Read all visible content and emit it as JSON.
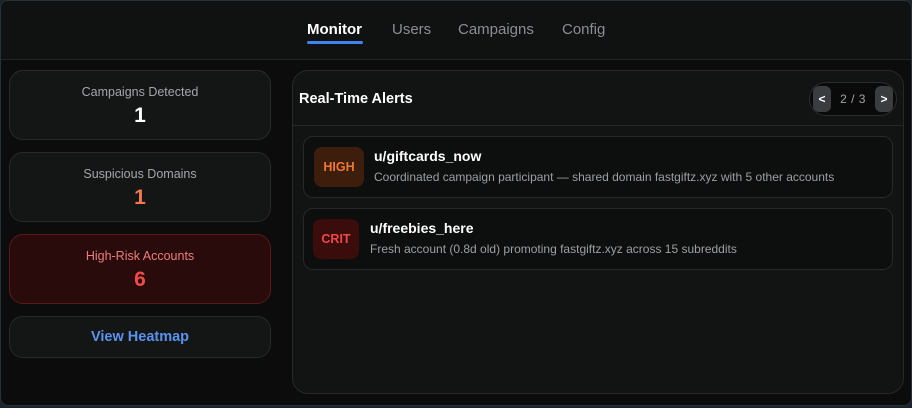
{
  "nav": {
    "tabs": [
      {
        "label": "Monitor",
        "active": true
      },
      {
        "label": "Users",
        "active": false
      },
      {
        "label": "Campaigns",
        "active": false
      },
      {
        "label": "Config",
        "active": false
      }
    ]
  },
  "stats": [
    {
      "label": "Campaigns Detected",
      "value": "1"
    },
    {
      "label": "Suspicious Domains",
      "value": "1"
    },
    {
      "label": "High-Risk Accounts",
      "value": "6"
    }
  ],
  "heatmap_button": "View Heatmap",
  "alerts": {
    "title": "Real-Time Alerts",
    "pager": {
      "prev": "<",
      "next": ">",
      "page_label": "2 / 3",
      "current": 2,
      "total": 3
    },
    "items": [
      {
        "severity": "HIGH",
        "user": "u/giftcards_now",
        "description": "Coordinated campaign participant — shared domain fastgiftz.xyz with 5 other accounts"
      },
      {
        "severity": "CRIT",
        "user": "u/freebies_here",
        "description": "Fresh account (0.8d old) promoting fastgiftz.xyz across 15 subreddits"
      }
    ]
  },
  "colors": {
    "accent": "#3f84f0",
    "high": "#f0772f",
    "critical": "#f04848",
    "danger_bg": "#2a0b0b"
  }
}
